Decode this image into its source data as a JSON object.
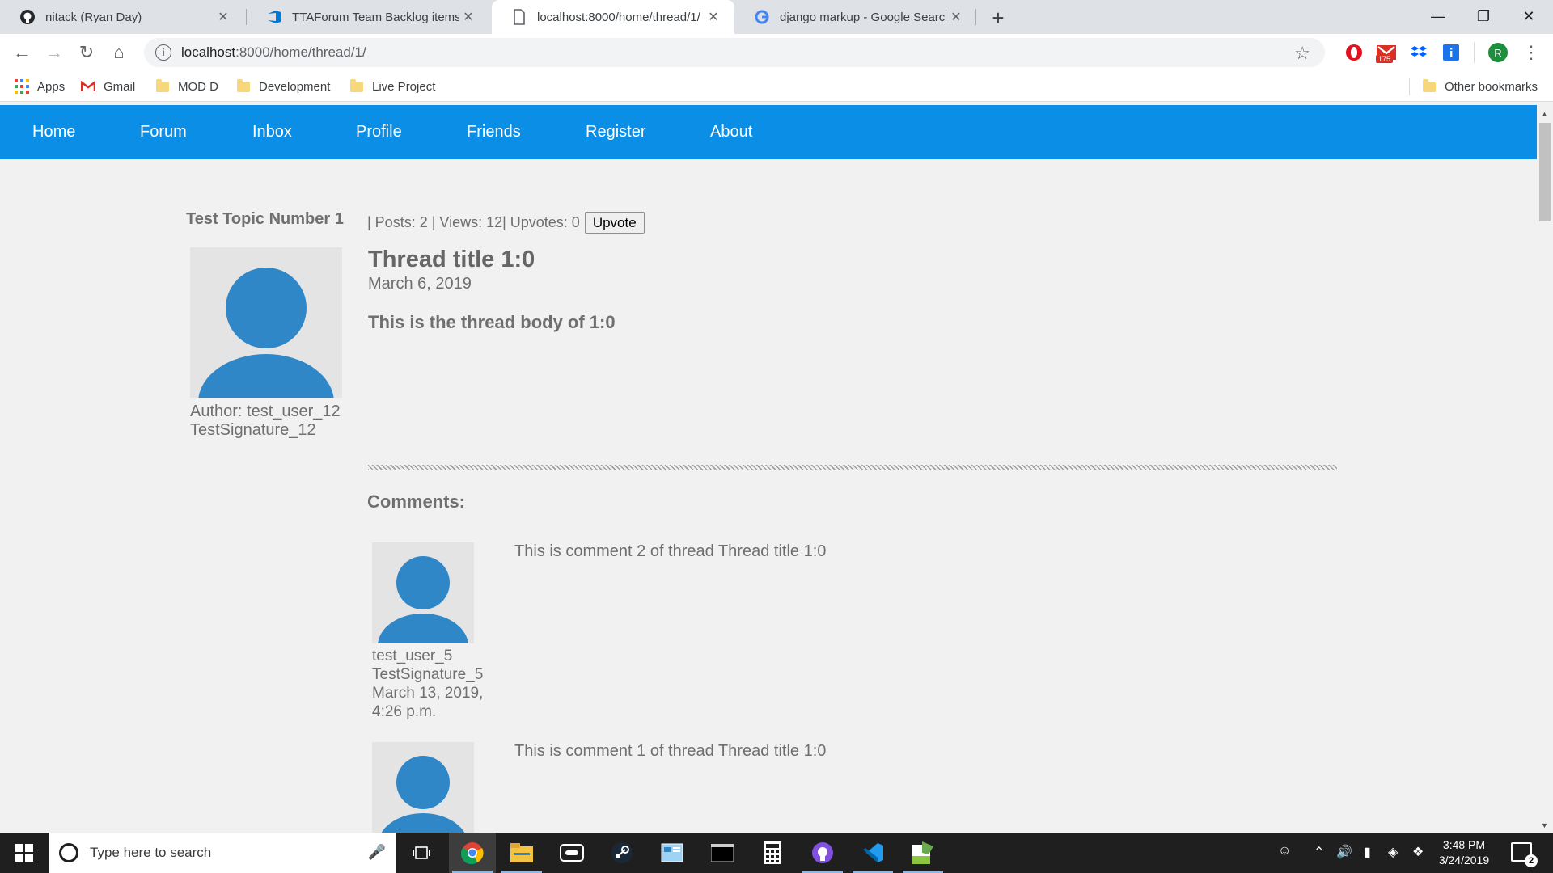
{
  "browser": {
    "tabs": [
      {
        "title": "nitack (Ryan Day)",
        "icon": "github-icon"
      },
      {
        "title": "TTAForum Team Backlog items B",
        "icon": "azure-devops-icon"
      },
      {
        "title": "localhost:8000/home/thread/1/",
        "icon": "page-icon"
      },
      {
        "title": "django markup - Google Search",
        "icon": "google-icon"
      }
    ],
    "url_host": "localhost",
    "url_rest": ":8000/home/thread/1/",
    "extension_badge": "175",
    "profile_initial": "R",
    "bookmarks": [
      "Apps",
      "Gmail",
      "MOD D",
      "Development",
      "Live Project"
    ],
    "other_bookmarks": "Other bookmarks"
  },
  "site_nav": [
    "Home",
    "Forum",
    "Inbox",
    "Profile",
    "Friends",
    "Register",
    "About"
  ],
  "thread": {
    "topic": "Test Topic Number 1",
    "stats": "| Posts: 2 | Views: 12| Upvotes: 0",
    "upvote_label": "Upvote",
    "title": "Thread title 1:0",
    "date": "March 6, 2019",
    "body": "This is the thread body of 1:0",
    "author": "Author: test_user_12",
    "signature": "TestSignature_12"
  },
  "comments_heading": "Comments:",
  "comments": [
    {
      "user": "test_user_5",
      "signature": "TestSignature_5",
      "date": "March 13, 2019,",
      "time": "4:26 p.m.",
      "text": "This is comment 2 of thread Thread title 1:0"
    },
    {
      "text": "This is comment 1 of thread Thread title 1:0"
    }
  ],
  "taskbar": {
    "search_placeholder": "Type here to search",
    "time": "3:48 PM",
    "date": "3/24/2019",
    "notifications": "2"
  },
  "colors": {
    "nav_blue": "#0a8ee6",
    "avatar_blue": "#2f87c8",
    "page_bg": "#f1f1f1"
  }
}
